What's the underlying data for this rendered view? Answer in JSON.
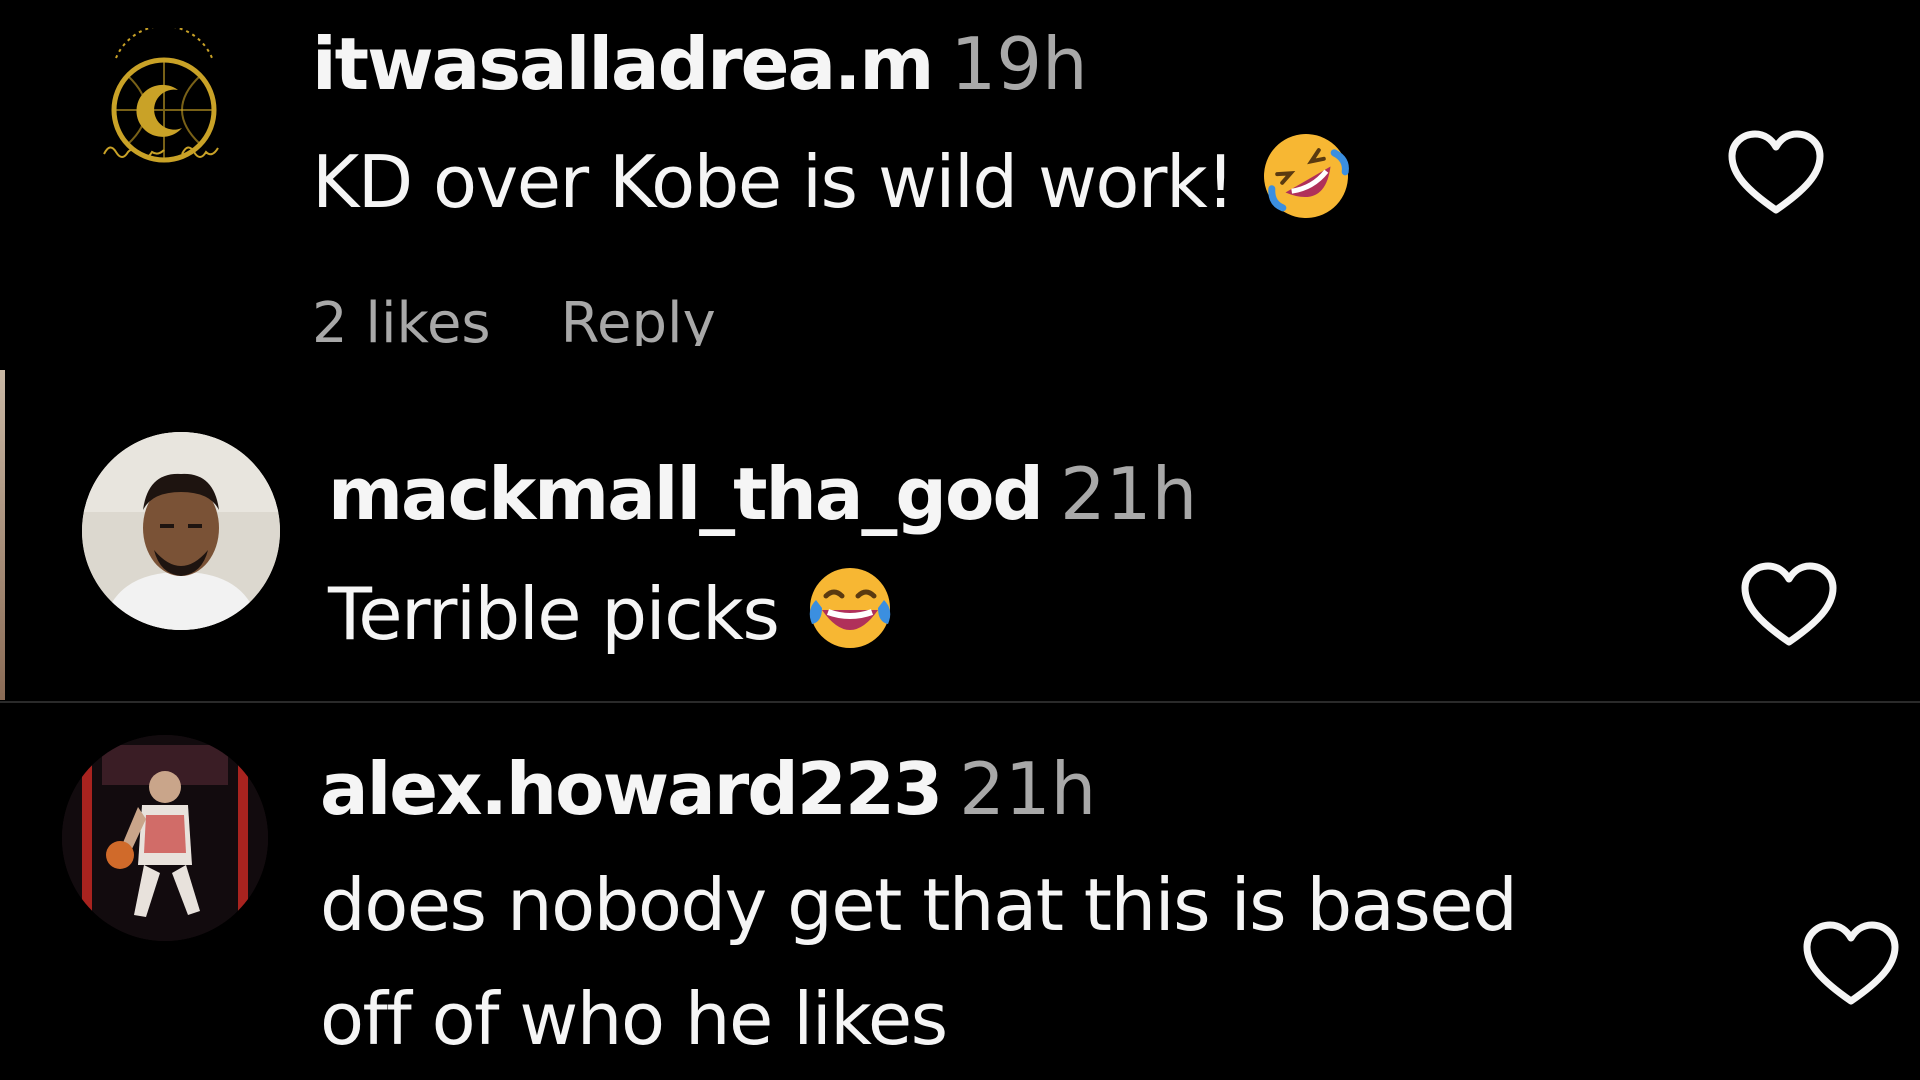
{
  "comments": [
    {
      "username": "itwasalladrea.m",
      "time": "19h",
      "text": "KD over Kobe is wild work!",
      "emoji": "rolling-on-floor-laughing",
      "likes": "2 likes",
      "reply": "Reply",
      "avatar": "itwasalladrea-logo-avatar"
    },
    {
      "username": "mackmall_tha_god",
      "time": "21h",
      "text": "Terrible picks",
      "emoji": "face-with-tears-of-joy",
      "avatar": "mackmall-photo-avatar"
    },
    {
      "username": "alex.howard223",
      "time": "21h",
      "text_line1": "does nobody get that this is based",
      "text_line2": "off of who he likes",
      "avatar": "alex-howard-photo-avatar"
    }
  ],
  "colors": {
    "background": "#000000",
    "primary_text": "#f5f5f5",
    "secondary_text": "#a8a8a8",
    "logo_gold": "#c9a227",
    "emoji_yellow": "#f7b733",
    "emoji_tear": "#3b8fe0",
    "emoji_mouth": "#b0305a"
  }
}
